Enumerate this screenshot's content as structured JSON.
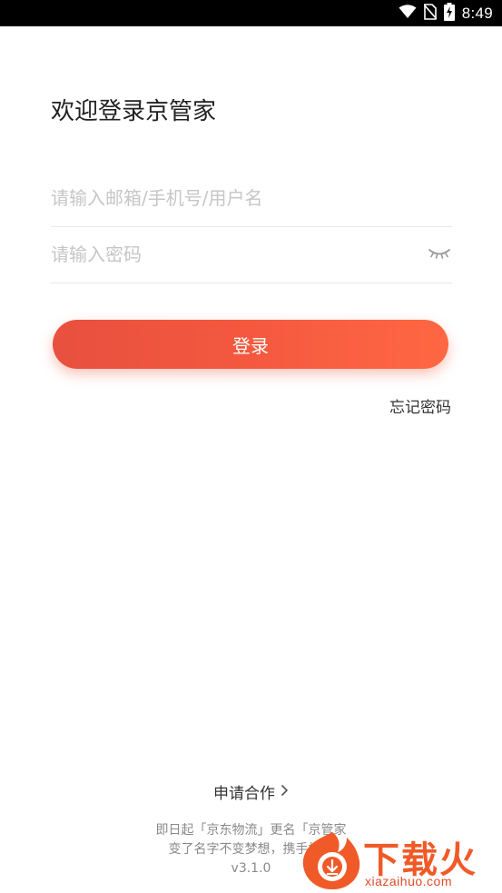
{
  "status_bar": {
    "time": "8:49"
  },
  "login": {
    "title": "欢迎登录京管家",
    "username_placeholder": "请输入邮箱/手机号/用户名",
    "password_placeholder": "请输入密码",
    "login_label": "登录",
    "forgot_label": "忘记密码"
  },
  "footer": {
    "partner_label": "申请合作",
    "notice_line1": "即日起「京东物流」更名「京管家",
    "notice_line2": "变了名字不变梦想，携手打造",
    "version": "v3.1.0"
  },
  "watermark": {
    "brand": "下载火",
    "url": "xiazaihuo.com"
  },
  "colors": {
    "accent_start": "#e8503f",
    "accent_end": "#ff6743",
    "placeholder": "#c6c6c6",
    "watermark": "#f05a28"
  }
}
